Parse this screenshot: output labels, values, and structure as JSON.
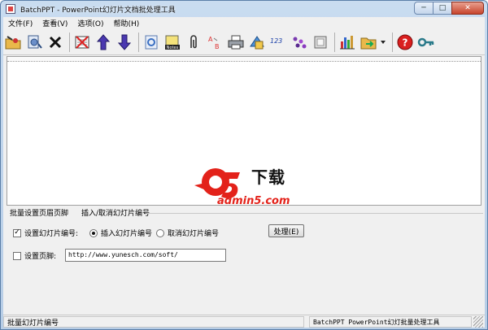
{
  "window": {
    "title": "BatchPPT - PowerPoint幻灯片文档批处理工具",
    "minimize": "─",
    "maximize": "□",
    "close": "✕"
  },
  "menu": [
    "文件(F)",
    "查看(V)",
    "选项(O)",
    "帮助(H)"
  ],
  "toolbar": {
    "icons": [
      "open-folder-icon",
      "add-files-icon",
      "delete-icon",
      "remove-list-icon",
      "move-up-icon",
      "move-down-icon",
      "background-icon",
      "notes-icon",
      "attachment-icon",
      "text-replace-icon",
      "print-icon",
      "layout-icon",
      "numbering-icon",
      "shapes-icon",
      "slide-icon",
      "chart-icon",
      "export-icon",
      "help-icon",
      "key-icon"
    ],
    "notes_label": "Notes",
    "numbering_label": "123"
  },
  "watermark": {
    "logo_text": "a5",
    "cn_text": "下载",
    "url": "admin5.com"
  },
  "tabs": [
    "批量设置页眉页脚",
    "插入/取消幻灯片编号"
  ],
  "panel": {
    "slide_number_label": "设置幻灯片编号:",
    "slide_number_checked": true,
    "insert_label": "插入幻灯片编号",
    "insert_selected": true,
    "cancel_label": "取消幻灯片编号",
    "cancel_selected": false,
    "process_button": "处理(E)",
    "footer_label": "设置页脚:",
    "footer_checked": false,
    "footer_value": "http://www.yunesch.com/soft/"
  },
  "status": {
    "left": "批量幻灯片编号",
    "right": "BatchPPT PowerPoint幻灯批量处理工具"
  }
}
